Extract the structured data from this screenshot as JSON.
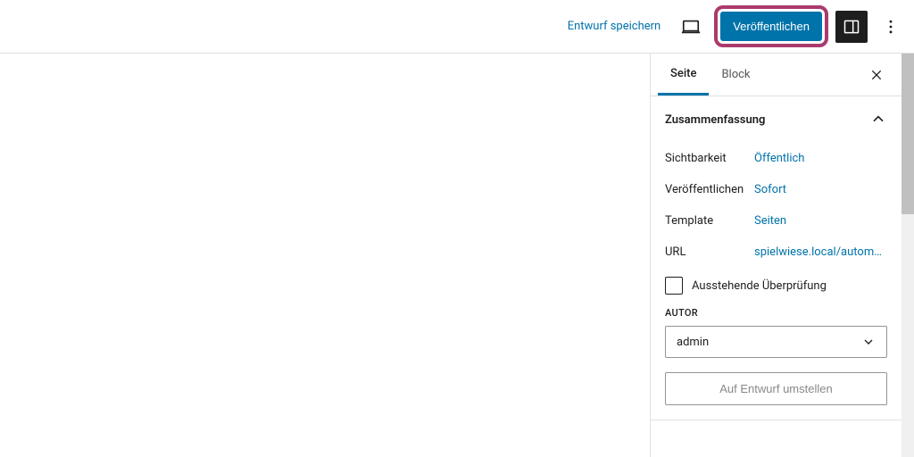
{
  "toolbar": {
    "save_draft": "Entwurf speichern",
    "publish": "Veröffentlichen"
  },
  "sidebar": {
    "tabs": {
      "page": "Seite",
      "block": "Block"
    },
    "summary": {
      "title": "Zusammenfassung",
      "visibility_label": "Sichtbarkeit",
      "visibility_value": "Öffentlich",
      "publish_label": "Veröffentlichen",
      "publish_value": "Sofort",
      "template_label": "Template",
      "template_value": "Seiten",
      "url_label": "URL",
      "url_value": "spielwiese.local/autom…",
      "pending_review": "Ausstehende Überprüfung",
      "author_label": "Autor",
      "author_value": "admin",
      "switch_to_draft": "Auf Entwurf umstellen"
    }
  }
}
